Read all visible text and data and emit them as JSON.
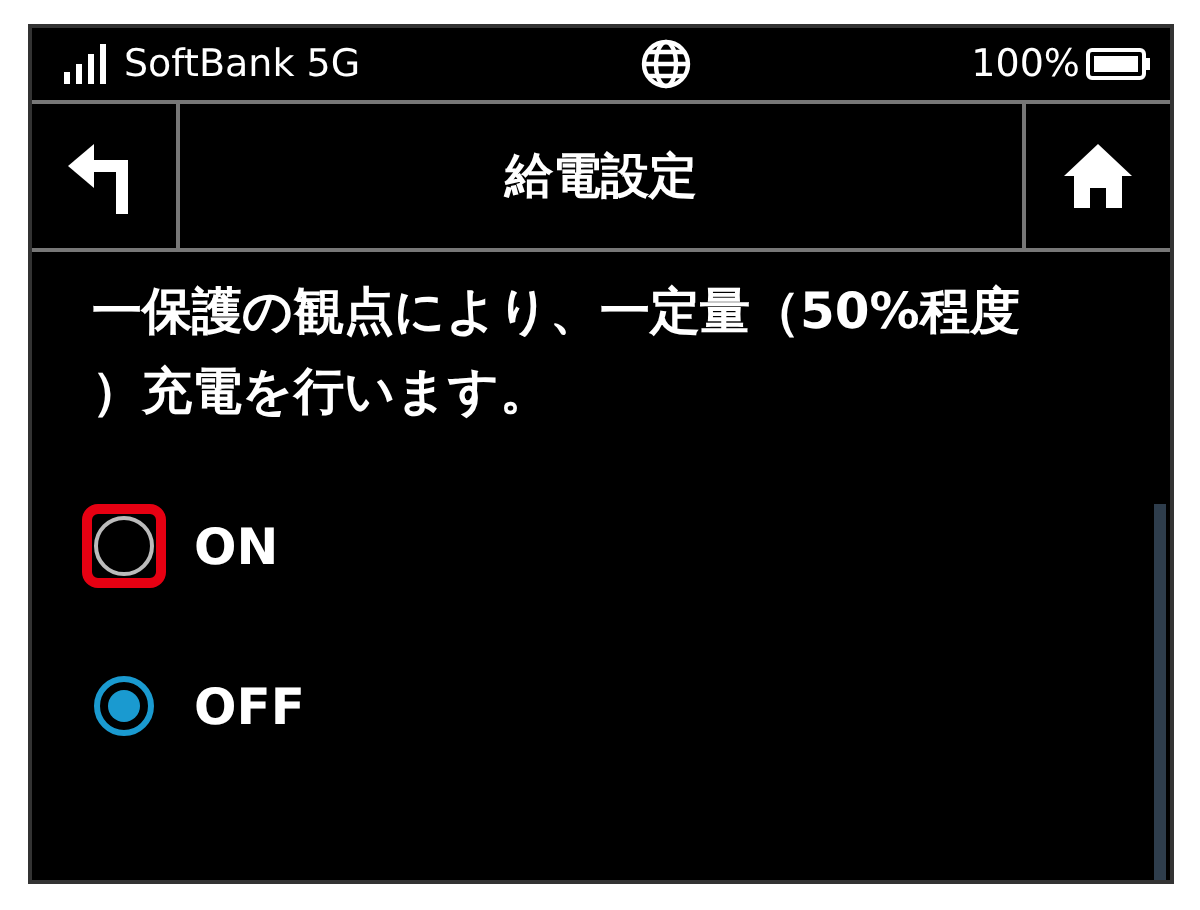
{
  "status_bar": {
    "carrier": "SoftBank 5G",
    "battery": "100%"
  },
  "header": {
    "title": "給電設定"
  },
  "description": {
    "lines": [
      "一保護の観点により、一定量（50%程度",
      "）充電を行います。"
    ]
  },
  "options": [
    {
      "label": "ON",
      "selected": false,
      "highlighted": true
    },
    {
      "label": "OFF",
      "selected": true,
      "highlighted": false
    }
  ]
}
